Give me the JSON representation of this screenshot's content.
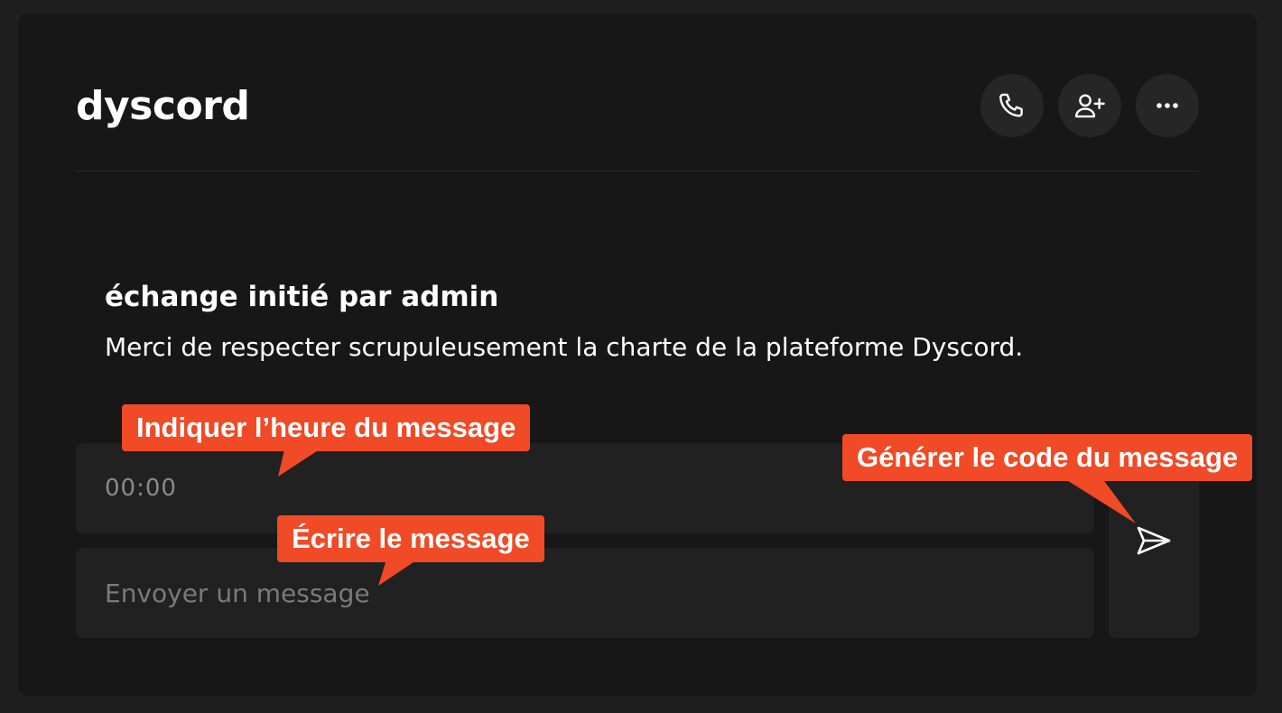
{
  "header": {
    "title": "dyscord",
    "actions": [
      {
        "name": "phone-icon"
      },
      {
        "name": "add-user-icon"
      },
      {
        "name": "more-icon"
      }
    ]
  },
  "notice": {
    "title": "échange initié par admin",
    "text": "Merci de respecter scrupuleusement la charte de la plateforme Dyscord."
  },
  "composer": {
    "time_placeholder": "00:00",
    "message_placeholder": "Envoyer un message",
    "send_icon": "send-icon"
  },
  "annotations": {
    "time_hint": "Indiquer l’heure du message",
    "message_hint": "Écrire le message",
    "send_hint": "Générer le code du message",
    "color": "#f04a26"
  }
}
